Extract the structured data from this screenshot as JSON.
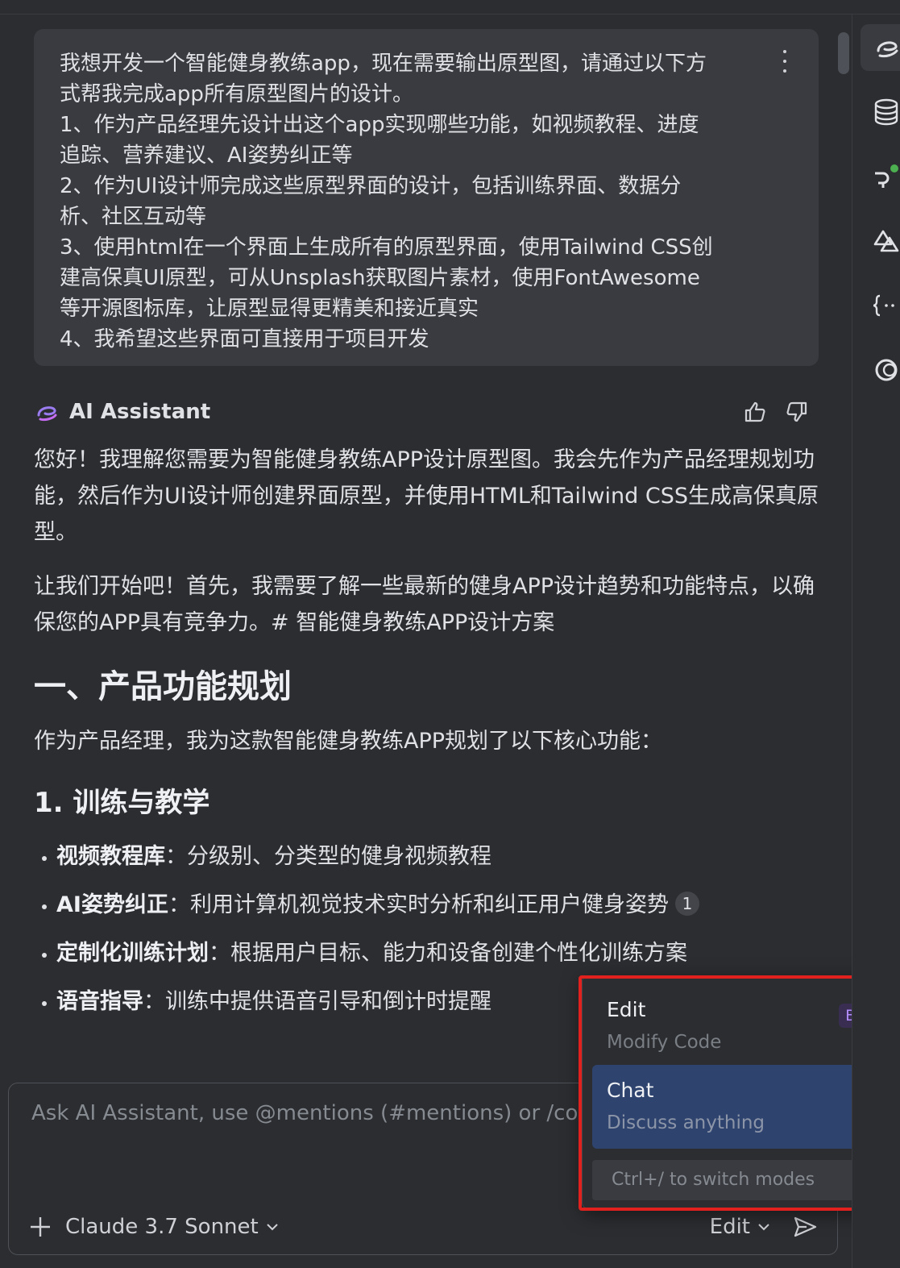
{
  "user_message": {
    "text": "我想开发一个智能健身教练app，现在需要输出原型图，请通过以下方\n式帮我完成app所有原型图片的设计。\n1、作为产品经理先设计出这个app实现哪些功能，如视频教程、进度\n追踪、营养建议、AI姿势纠正等\n2、作为UI设计师完成这些原型界面的设计，包括训练界面、数据分\n析、社区互动等\n3、使用html在一个界面上生成所有的原型界面，使用Tailwind CSS创\n建高保真UI原型，可从Unsplash获取图片素材，使用FontAwesome\n等开源图标库，让原型显得更精美和接近真实\n4、我希望这些界面可直接用于项目开发"
  },
  "assistant": {
    "name": "AI Assistant",
    "paragraph1": "您好！我理解您需要为智能健身教练APP设计原型图。我会先作为产品经理规划功能，然后作为UI设计师创建界面原型，并使用HTML和Tailwind CSS生成高保真原型。",
    "paragraph2": "让我们开始吧！首先，我需要了解一些最新的健身APP设计趋势和功能特点，以确保您的APP具有竞争力。# 智能健身教练APP设计方案",
    "heading1": "一、产品功能规划",
    "intro": "作为产品经理，我为这款智能健身教练APP规划了以下核心功能：",
    "heading2": "1. 训练与教学",
    "bullets": [
      {
        "title": "视频教程库",
        "text": "：分级别、分类型的健身视频教程"
      },
      {
        "title": "AI姿势纠正",
        "text": "：利用计算机视觉技术实时分析和纠正用户健身姿势",
        "cite": "1"
      },
      {
        "title": "定制化训练计划",
        "text": "：根据用户目标、能力和设备创建个性化训练方案"
      },
      {
        "title": "语音指导",
        "text": "：训练中提供语音引导和倒计时提醒"
      }
    ]
  },
  "input": {
    "placeholder": "Ask AI Assistant, use @mentions (#mentions) or /comm",
    "model": "Claude 3.7 Sonnet",
    "mode": "Edit"
  },
  "mode_popup": {
    "items": [
      {
        "title": "Edit",
        "subtitle": "Modify Code",
        "badge": "Beta"
      },
      {
        "title": "Chat",
        "subtitle": "Discuss anything"
      }
    ],
    "footer": "Ctrl+/ to switch modes"
  },
  "colors": {
    "background": "#2b2d30",
    "bubble": "#393b40",
    "selected": "#2e436e",
    "highlight": "#e0211d",
    "badge": "#b28cff",
    "accent": "#9a7cf0"
  }
}
